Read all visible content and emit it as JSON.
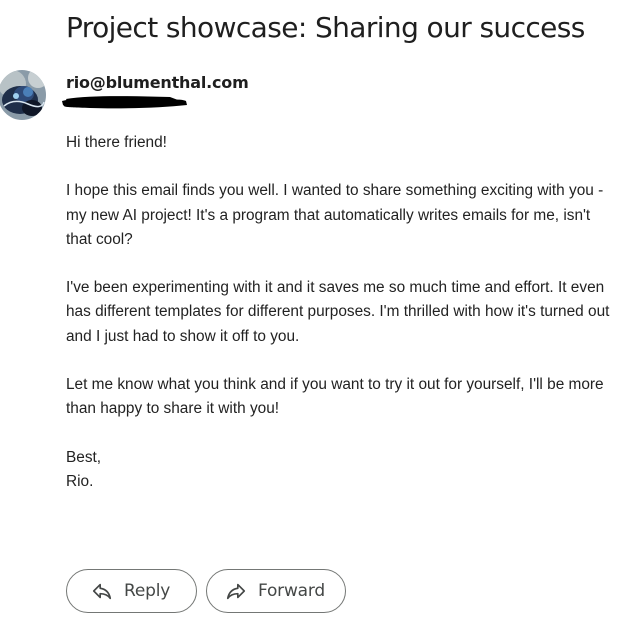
{
  "email": {
    "subject": "Project showcase: Sharing our success",
    "sender": "rio@blumenthal.com",
    "body": {
      "greeting": "Hi there friend!",
      "paragraph_1": "I hope this email finds you well. I wanted to share something exciting with you - my new AI project! It's a program that automatically writes emails for me, isn't that cool?",
      "paragraph_2": "I've been experimenting with it and it saves me so much time and effort. It even has different templates for different purposes. I'm thrilled with how it's turned out and I just had to show it off to you.",
      "paragraph_3": "Let me know what you think and if you want to try it out for yourself, I'll be more than happy to share it with you!",
      "closing": "Best,",
      "signature": "Rio."
    }
  },
  "actions": {
    "reply_label": "Reply",
    "forward_label": "Forward"
  },
  "icons": {
    "reply": "reply-arrow-icon",
    "forward": "forward-arrow-icon"
  },
  "colors": {
    "button_border": "#747775",
    "text": "#202124",
    "redaction": "#000000"
  }
}
